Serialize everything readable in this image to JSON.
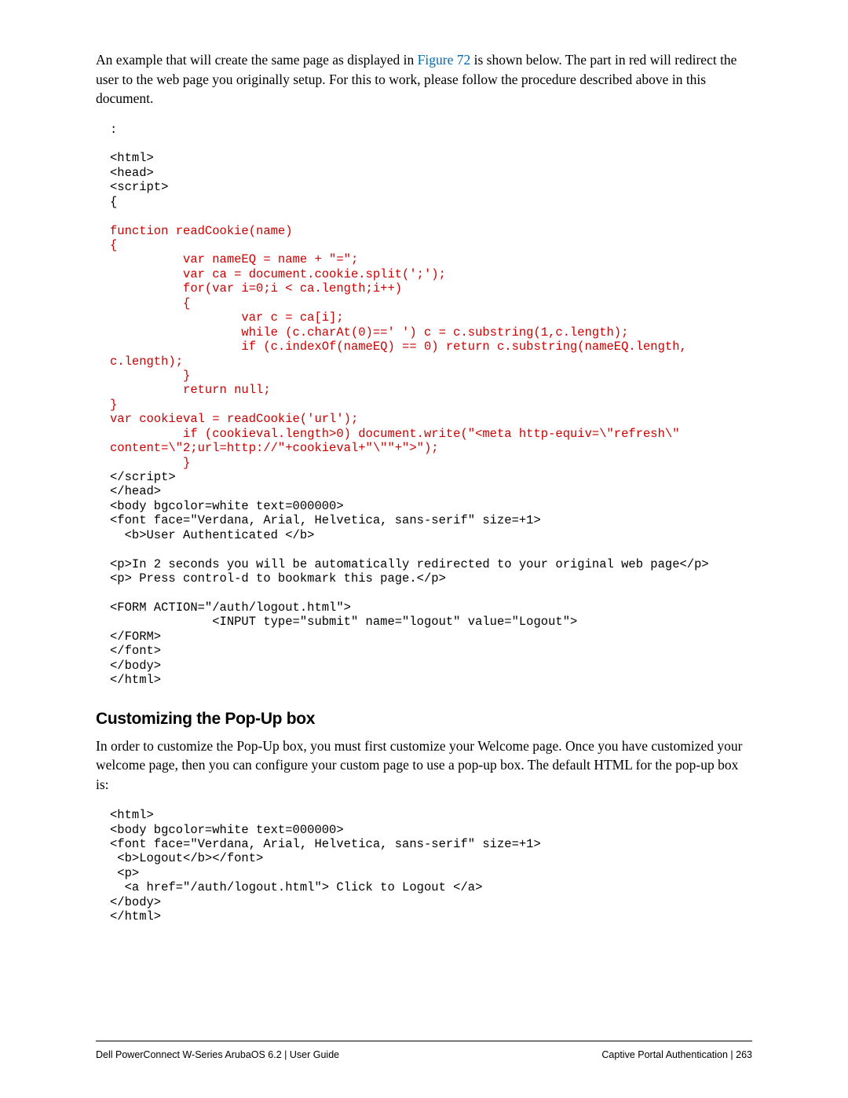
{
  "intro": {
    "part1": "An example that will create the same page as displayed in ",
    "figure_link": "Figure 72",
    "part2": " is shown below. The part in red will redirect the user to the web page you originally setup. For this to work, please follow the procedure described above in this document."
  },
  "code1": {
    "line1": ":",
    "line2": "<html>",
    "line3": "<head>",
    "line4": "<script>",
    "line5": "{",
    "line6": "function readCookie(name)",
    "line7": "{",
    "line8": "          var nameEQ = name + \"=\";",
    "line9": "          var ca = document.cookie.split(';');",
    "line10": "          for(var i=0;i < ca.length;i++)",
    "line11": "          {",
    "line12": "                  var c = ca[i];",
    "line13": "                  while (c.charAt(0)==' ') c = c.substring(1,c.length);",
    "line14": "                  if (c.indexOf(nameEQ) == 0) return c.substring(nameEQ.length,",
    "line15": "c.length);",
    "line16": "          }",
    "line17": "          return null;",
    "line18": "}",
    "line19": "var cookieval = readCookie('url');",
    "line20": "          if (cookieval.length>0) document.write(\"<meta http-equiv=\\\"refresh\\\"",
    "line21": "content=\\\"2;url=http://\"+cookieval+\"\\\"\"+\">\");",
    "line22": "          }",
    "line23": "</script>",
    "line24": "</head>",
    "line25": "<body bgcolor=white text=000000>",
    "line26": "<font face=\"Verdana, Arial, Helvetica, sans-serif\" size=+1>",
    "line27": "  <b>User Authenticated </b>",
    "line28": "<p>In 2 seconds you will be automatically redirected to your original web page</p>",
    "line29": "<p> Press control-d to bookmark this page.</p>",
    "line30": "<FORM ACTION=\"/auth/logout.html\">",
    "line31": "              <INPUT type=\"submit\" name=\"logout\" value=\"Logout\">",
    "line32": "</FORM>",
    "line33": "</font>",
    "line34": "</body>",
    "line35": "</html>"
  },
  "heading": "Customizing the Pop-Up box",
  "section_text": "In order to customize the Pop-Up box, you must first customize your Welcome page. Once you have customized your welcome page, then you can configure your custom page to use a pop-up box. The default HTML for the pop-up box is:",
  "code2": {
    "line1": "<html>",
    "line2": "<body bgcolor=white text=000000>",
    "line3": "<font face=\"Verdana, Arial, Helvetica, sans-serif\" size=+1>",
    "line4": " <b>Logout</b></font>",
    "line5": " <p>",
    "line6": "  <a href=\"/auth/logout.html\"> Click to Logout </a>",
    "line7": "</body>",
    "line8": "</html>"
  },
  "footer": {
    "left": "Dell PowerConnect W-Series ArubaOS 6.2 | User Guide",
    "right_label": "Captive Portal Authentication",
    "right_sep": "  |  ",
    "right_page": "263"
  }
}
